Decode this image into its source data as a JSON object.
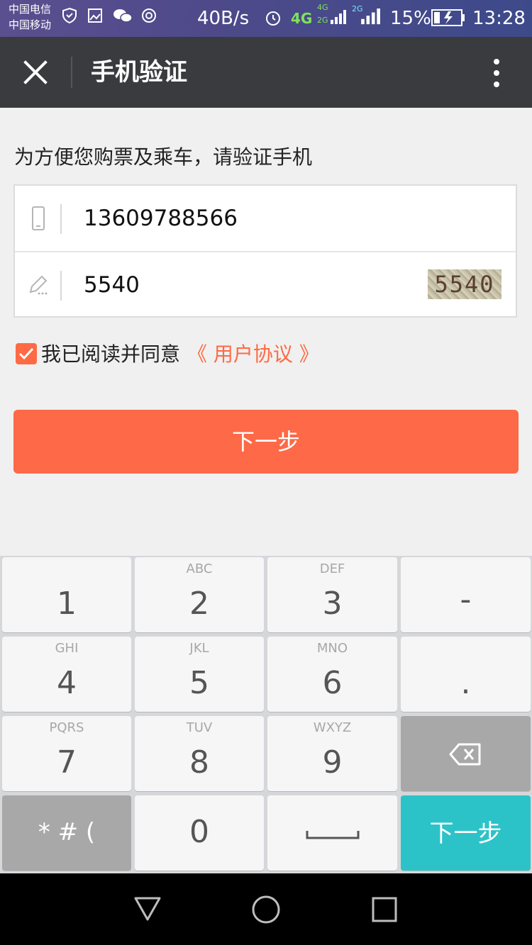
{
  "status_bar": {
    "carrier_1": "中国电信",
    "carrier_2": "中国移动",
    "speed": "40B/s",
    "network_4g": "4G",
    "signal_label_4g": "4G",
    "signal_label_2g_a": "2G",
    "signal_label_2g_b": "2G",
    "battery_percent": "15%",
    "time": "13:28"
  },
  "app_bar": {
    "title": "手机验证",
    "close_icon": "close-icon",
    "more_icon": "more-vertical-icon"
  },
  "form": {
    "prompt": "为方便您购票及乘车，请验证手机",
    "phone_value": "13609788566",
    "code_value": "5540",
    "captcha_text": "5540",
    "agree_checked": true,
    "agree_text": "我已阅读并同意",
    "agree_link": "《 用户协议 》",
    "next_button": "下一步"
  },
  "keyboard": {
    "keys": [
      {
        "main": "1",
        "sub": ""
      },
      {
        "main": "2",
        "sub": "ABC"
      },
      {
        "main": "3",
        "sub": "DEF"
      },
      {
        "main": "-",
        "sub": ""
      },
      {
        "main": "4",
        "sub": "GHI"
      },
      {
        "main": "5",
        "sub": "JKL"
      },
      {
        "main": "6",
        "sub": "MNO"
      },
      {
        "main": ".",
        "sub": ""
      },
      {
        "main": "7",
        "sub": "PQRS"
      },
      {
        "main": "8",
        "sub": "TUV"
      },
      {
        "main": "9",
        "sub": "WXYZ"
      },
      {
        "main": "",
        "sub": ""
      },
      {
        "main": "* # (",
        "sub": ""
      },
      {
        "main": "0",
        "sub": ""
      },
      {
        "main": "",
        "sub": ""
      },
      {
        "main": "下一步",
        "sub": ""
      }
    ]
  },
  "colors": {
    "accent": "#fe6947",
    "app_bar": "#3a3b3f",
    "keyboard_enter": "#2cc3c8"
  }
}
